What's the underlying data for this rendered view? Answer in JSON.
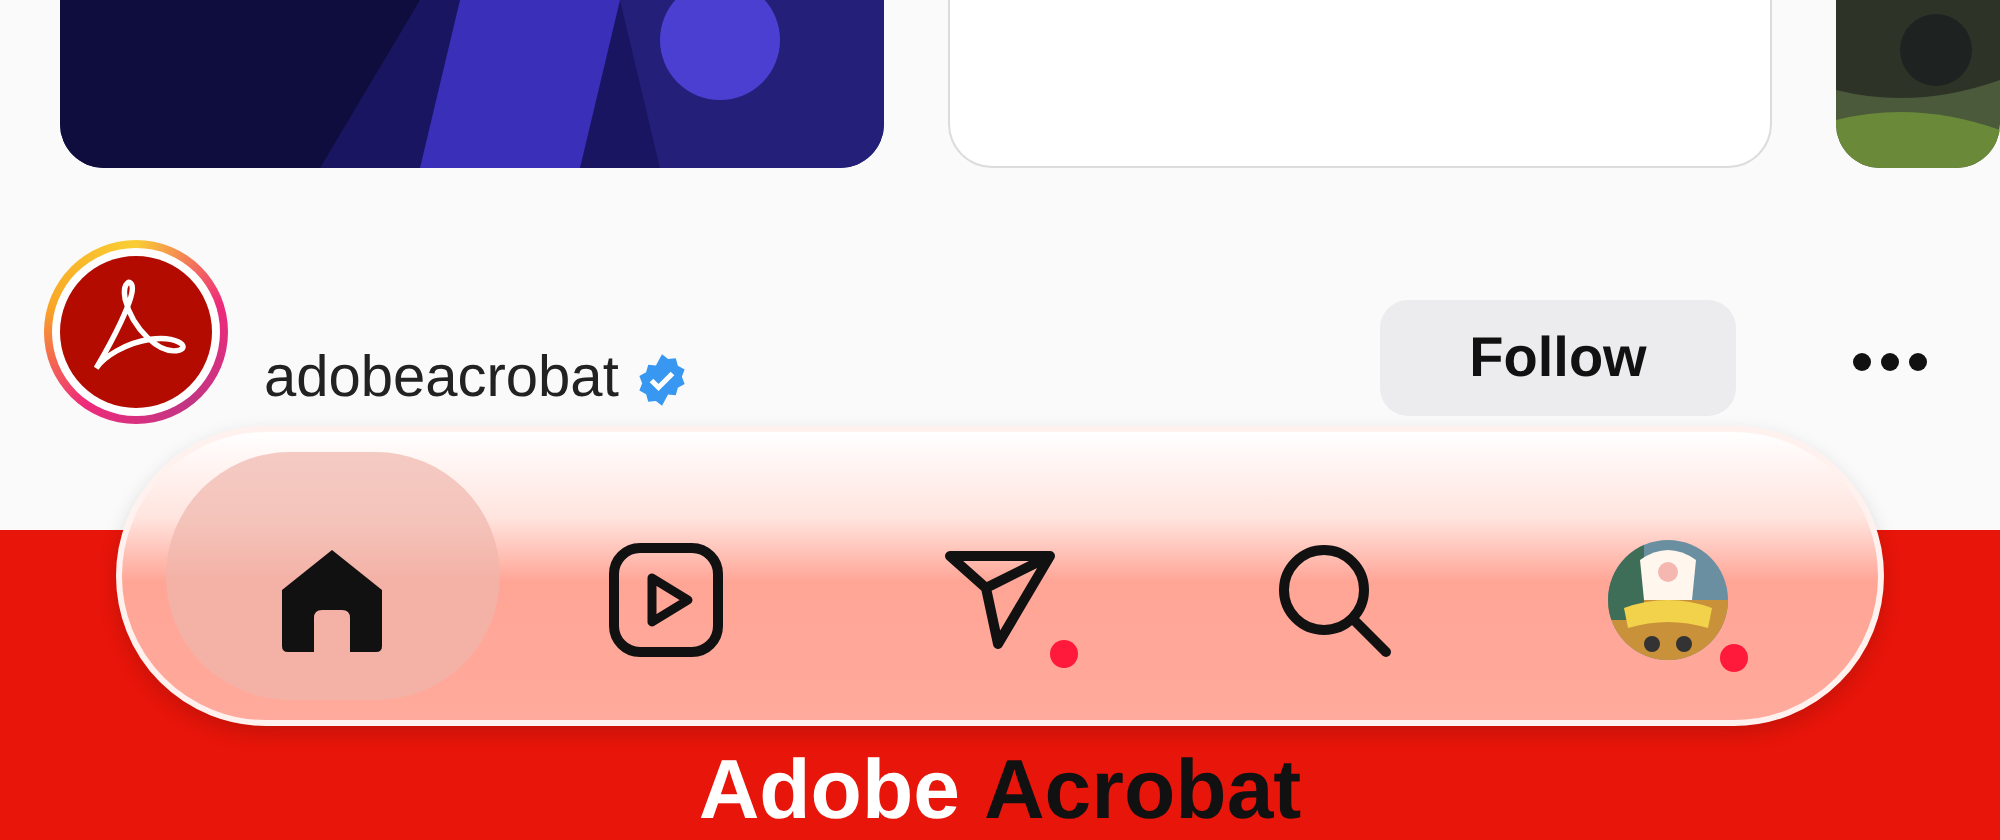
{
  "posts": [
    {
      "kind": "picture"
    },
    {
      "kind": "blank"
    },
    {
      "kind": "picture"
    }
  ],
  "post_header": {
    "username": "adobeacrobat",
    "verified": true,
    "has_story": true,
    "follow_button": "Follow"
  },
  "banner": {
    "title_parts": [
      "Adobe",
      "Acrobat"
    ]
  },
  "nav_bar": {
    "items": [
      {
        "kind": "home",
        "selected": true,
        "badge": false
      },
      {
        "kind": "reels",
        "selected": false,
        "badge": false
      },
      {
        "kind": "messages",
        "selected": false,
        "badge": true
      },
      {
        "kind": "search",
        "selected": false,
        "badge": false
      },
      {
        "kind": "profile",
        "selected": false,
        "badge": true
      }
    ]
  }
}
